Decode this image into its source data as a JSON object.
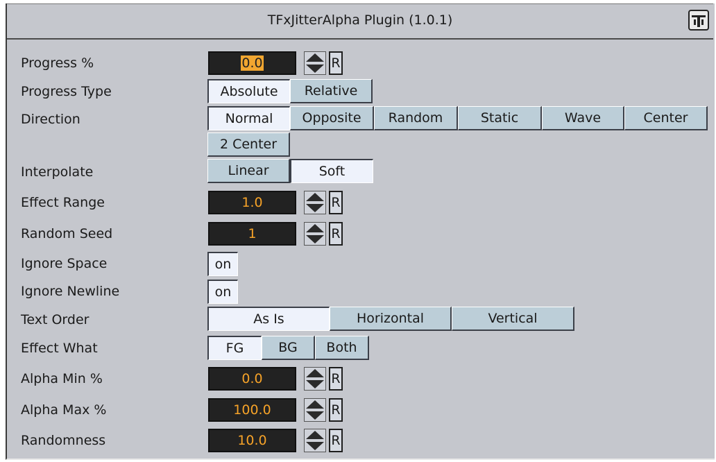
{
  "window": {
    "title": "TFxJitterAlpha Plugin (1.0.1)"
  },
  "rows": {
    "progress": {
      "label": "Progress %",
      "value": "0.0",
      "reset": "R"
    },
    "progress_type": {
      "label": "Progress Type",
      "options": [
        "Absolute",
        "Relative"
      ],
      "selected": "Absolute"
    },
    "direction": {
      "label": "Direction",
      "options": [
        "Normal",
        "Opposite",
        "Random",
        "Static",
        "Wave",
        "Center",
        "2 Center"
      ],
      "selected": "Normal"
    },
    "interpolate": {
      "label": "Interpolate",
      "options": [
        "Linear",
        "Soft"
      ],
      "selected": "Soft"
    },
    "effect_range": {
      "label": "Effect Range",
      "value": "1.0",
      "reset": "R"
    },
    "random_seed": {
      "label": "Random Seed",
      "value": "1",
      "reset": "R"
    },
    "ignore_space": {
      "label": "Ignore Space",
      "toggle": "on"
    },
    "ignore_newline": {
      "label": "Ignore Newline",
      "toggle": "on"
    },
    "text_order": {
      "label": "Text Order",
      "options": [
        "As Is",
        "Horizontal",
        "Vertical"
      ],
      "selected": "As Is"
    },
    "effect_what": {
      "label": "Effect What",
      "options": [
        "FG",
        "BG",
        "Both"
      ],
      "selected": "FG"
    },
    "alpha_min": {
      "label": "Alpha Min %",
      "value": "0.0",
      "reset": "R"
    },
    "alpha_max": {
      "label": "Alpha Max %",
      "value": "100.0",
      "reset": "R"
    },
    "randomness": {
      "label": "Randomness",
      "value": "10.0",
      "reset": "R"
    }
  },
  "icons": {
    "logo": "vizrt-plugin-logo-icon",
    "spinner": "up-down-spinner-icon"
  },
  "colors": {
    "panel": "#c5c7cd",
    "field_bg": "#222222",
    "field_text": "#f7a328",
    "button": "#bcced8",
    "button_selected": "#eef2fb"
  }
}
